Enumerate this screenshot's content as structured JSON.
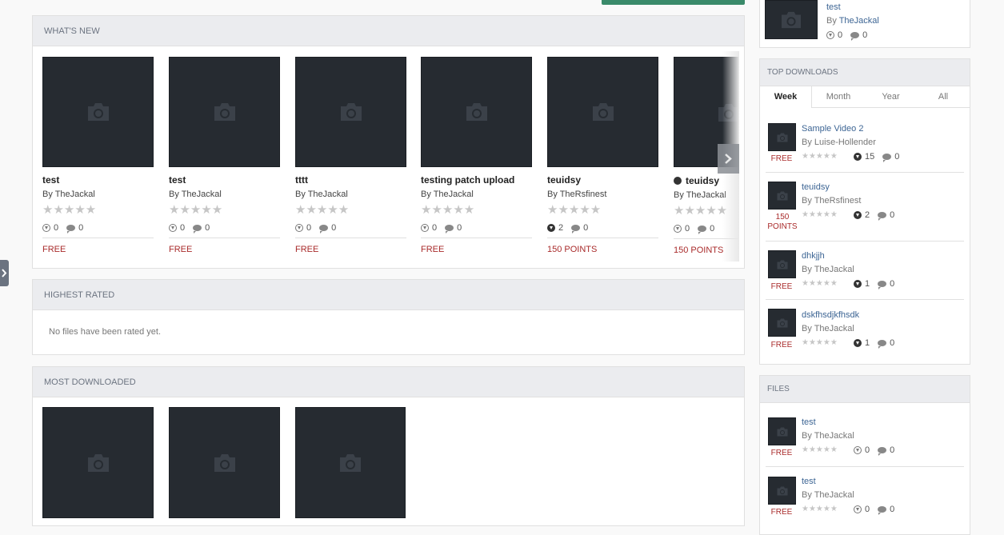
{
  "whats_new": {
    "heading": "WHAT'S NEW",
    "cards": [
      {
        "title": "test",
        "author": "By TheJackal",
        "downloads": "0",
        "comments": "0",
        "price": "FREE"
      },
      {
        "title": "test",
        "author": "By TheJackal",
        "downloads": "0",
        "comments": "0",
        "price": "FREE"
      },
      {
        "title": "tttt",
        "author": "By TheJackal",
        "downloads": "0",
        "comments": "0",
        "price": "FREE"
      },
      {
        "title": "testing patch upload",
        "author": "By TheJackal",
        "downloads": "0",
        "comments": "0",
        "price": "FREE"
      },
      {
        "title": "teuidsy",
        "author": "By TheRsfinest",
        "downloads": "2",
        "comments": "0",
        "price": "150 POINTS"
      },
      {
        "title": "teuidsy",
        "author": "By TheJackal",
        "downloads": "0",
        "comments": "0",
        "price": "150 POINTS"
      }
    ]
  },
  "highest_rated": {
    "heading": "HIGHEST RATED",
    "empty_text": "No files have been rated yet."
  },
  "most_downloaded": {
    "heading": "MOST DOWNLOADED"
  },
  "sidebar_top_file": {
    "title": "test",
    "by_prefix": "By",
    "author": "TheJackal",
    "downloads": "0",
    "comments": "0"
  },
  "top_downloads": {
    "heading": "TOP DOWNLOADS",
    "tabs": [
      "Week",
      "Month",
      "Year",
      "All"
    ],
    "active_tab": "Week",
    "items": [
      {
        "title": "Sample Video 2",
        "author": "By Luise-Hollender",
        "price": "FREE",
        "downloads": "15",
        "comments": "0"
      },
      {
        "title": "teuidsy",
        "author": "By TheRsfinest",
        "price": "150 POINTS",
        "downloads": "2",
        "comments": "0"
      },
      {
        "title": "dhkjjh",
        "author": "By TheJackal",
        "price": "FREE",
        "downloads": "1",
        "comments": "0"
      },
      {
        "title": "dskfhsdjkfhsdk",
        "author": "By TheJackal",
        "price": "FREE",
        "downloads": "1",
        "comments": "0"
      }
    ]
  },
  "files": {
    "heading": "FILES",
    "items": [
      {
        "title": "test",
        "author": "By TheJackal",
        "price": "FREE",
        "downloads": "0",
        "comments": "0"
      },
      {
        "title": "test",
        "author": "By TheJackal",
        "price": "FREE",
        "downloads": "0",
        "comments": "0"
      }
    ]
  },
  "icons": {
    "camera": "camera-icon",
    "carousel_next": "chevron-right-icon",
    "side_toggle": "chevron-right-icon"
  },
  "colors": {
    "price": "#a92b2b",
    "link": "#3d6594",
    "thumb": "#262b31",
    "accent_button": "#3a8a6a"
  }
}
